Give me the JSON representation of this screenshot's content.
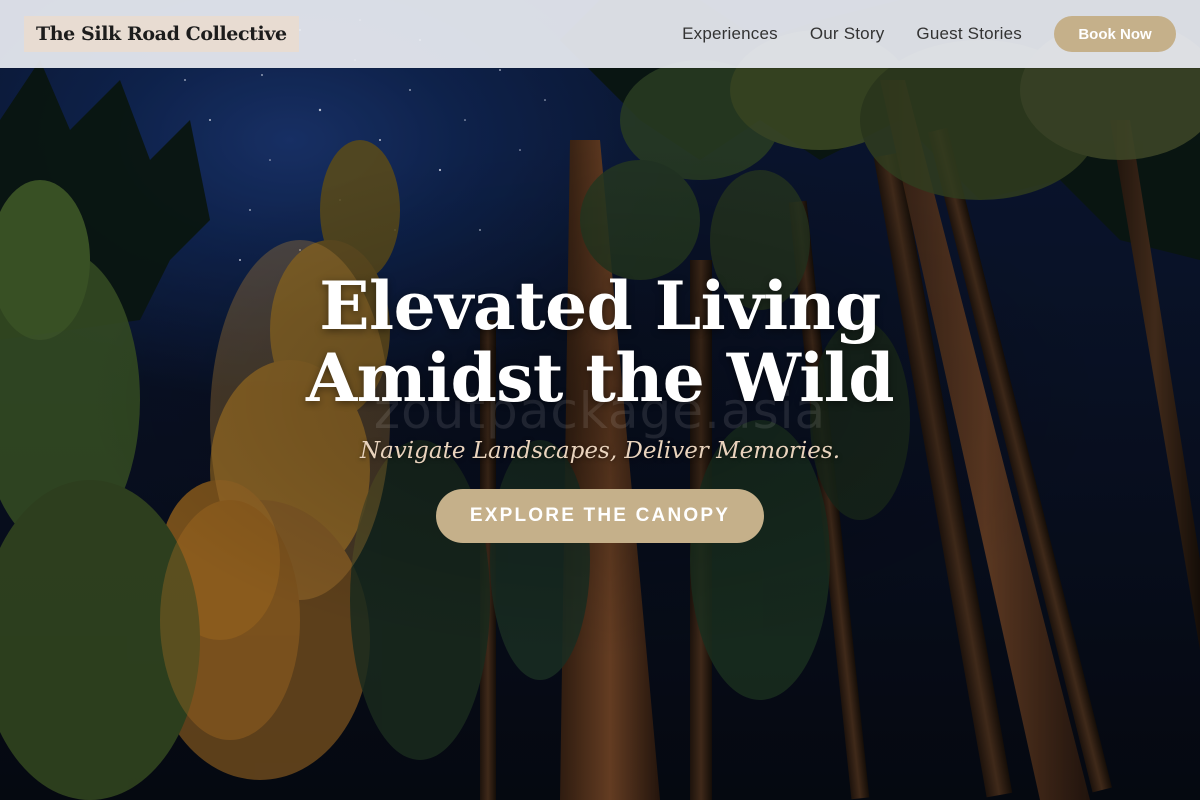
{
  "header": {
    "logo_text": "The Silk Road Collective",
    "nav": [
      "Experiences",
      "Our Story",
      "Guest Stories"
    ],
    "cta_label": "Book Now"
  },
  "hero": {
    "headline_line1": "Elevated Living",
    "headline_line2": "Amidst the Wild",
    "tagline": "Navigate Landscapes, Deliver Memories.",
    "cta_label": "EXPLORE THE CANOPY",
    "watermark": "zoutpackage.asia"
  },
  "colors": {
    "accent": "#c5b08a",
    "header_bg": "#e9ecf2",
    "logo_bg": "#e8dcd2",
    "tagline": "#e9d3bd"
  }
}
